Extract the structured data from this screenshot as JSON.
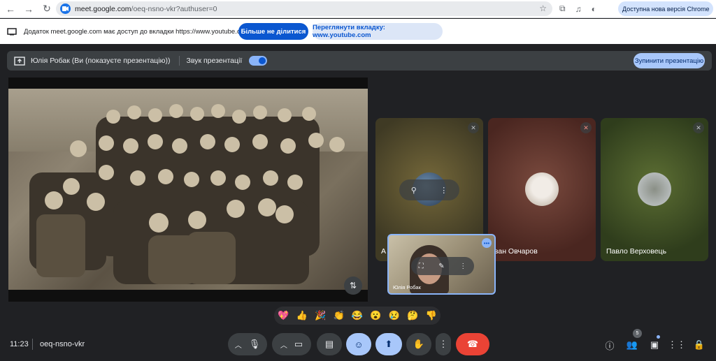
{
  "browser": {
    "url_host": "meet.google.com",
    "url_path": "/oeq-nsno-vkr?authuser=0",
    "update_label": "Доступна нова версія Chrome"
  },
  "share_notice": {
    "message": "Додаток meet.google.com має доступ до вкладки https://www.youtube.com",
    "stop_sharing_label": "Більше не ділитися",
    "view_tab_label": "Переглянути вкладку: www.youtube.com"
  },
  "presenting_bar": {
    "presenter_label": "Юлія Робак (Ви (показуєте презентацію))",
    "audio_label": "Звук презентації",
    "audio_enabled": true,
    "stop_label": "Зупинити презентацію"
  },
  "participants": [
    {
      "name": "А",
      "muted": true
    },
    {
      "name": "Іван Овчаров",
      "muted": true
    },
    {
      "name": "Павло Верховець",
      "muted": true
    }
  ],
  "self_view": {
    "name": "Юлія Робак"
  },
  "reactions": [
    "💖",
    "👍",
    "🎉",
    "👏",
    "😂",
    "😮",
    "😢",
    "🤔",
    "👎"
  ],
  "footer": {
    "time": "11:23",
    "meeting_code": "oeq-nsno-vkr",
    "people_count": "5"
  },
  "colors": {
    "accent": "#a8c7fa",
    "end_call": "#ea4335",
    "background": "#202124"
  }
}
